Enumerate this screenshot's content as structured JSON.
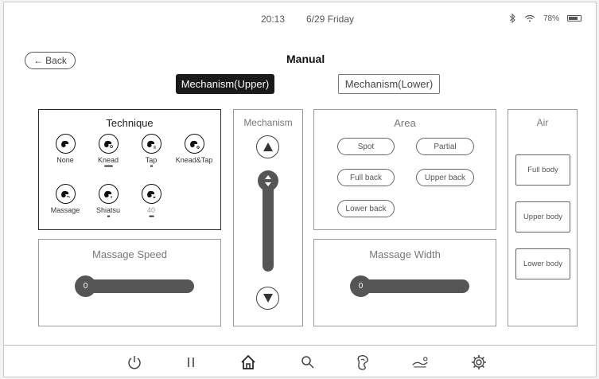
{
  "status_bar": {
    "time": "20:13",
    "date": "6/29 Friday",
    "battery": "78%",
    "icons": [
      "bluetooth-icon",
      "wifi-icon",
      "battery-icon"
    ]
  },
  "header": {
    "back_label": "Back",
    "title": "Manual"
  },
  "mechanism_tabs": [
    {
      "label": "Mechanism(Upper)",
      "active": true
    },
    {
      "label": "Mechanism(Lower)",
      "active": false
    }
  ],
  "technique": {
    "title": "Technique",
    "items": [
      {
        "label": "None",
        "dots": ""
      },
      {
        "label": "Knead",
        "dots": "•••••••"
      },
      {
        "label": "Tap",
        "dots": "••"
      },
      {
        "label": "Knead&Tap",
        "dots": ""
      },
      {
        "label": "Massage",
        "dots": ""
      },
      {
        "label": "Shiatsu",
        "dots": "••"
      },
      {
        "label": "40",
        "dots": "••••"
      }
    ]
  },
  "mechanism": {
    "title": "Mechanism",
    "up_icon": "triangle-up-icon",
    "down_icon": "triangle-down-icon"
  },
  "area": {
    "title": "Area",
    "options": [
      "Spot",
      "Partial",
      "Full back",
      "Upper back",
      "Lower back"
    ]
  },
  "air": {
    "title": "Air",
    "options": [
      "Full body",
      "Upper body",
      "Lower body"
    ]
  },
  "massage_speed": {
    "title": "Massage Speed",
    "value": "0"
  },
  "massage_width": {
    "title": "Massage Width",
    "value": "0"
  },
  "bottom_nav": [
    "power-icon",
    "pause-icon",
    "home-icon",
    "search-icon",
    "foot-massage-icon",
    "recline-icon",
    "settings-icon"
  ],
  "colors": {
    "accent_dark": "#1a1a1a",
    "slider": "#555555"
  }
}
